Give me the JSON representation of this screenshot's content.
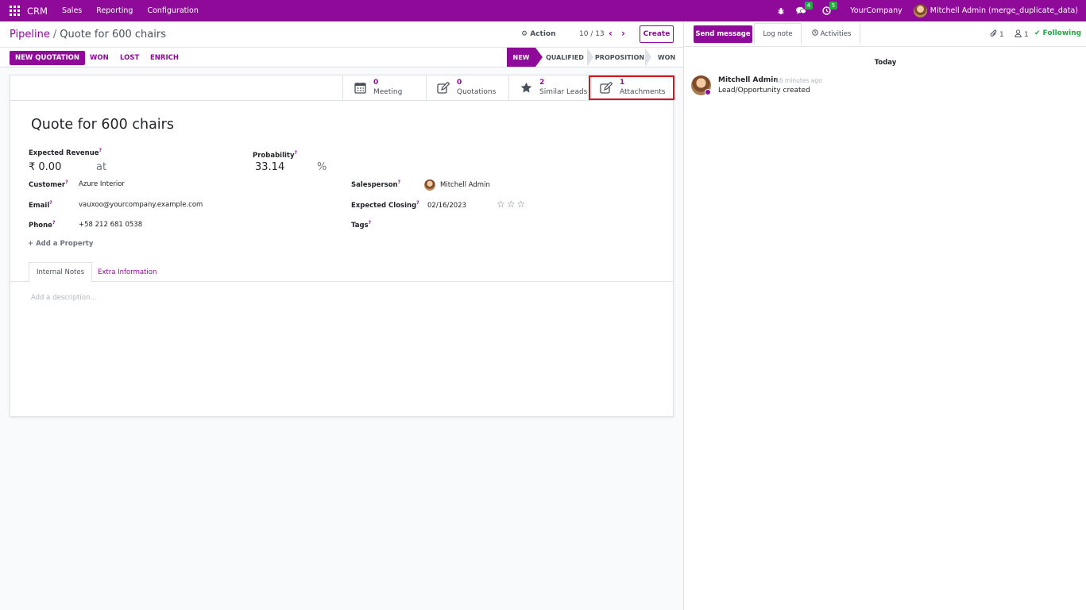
{
  "topbar": {
    "brand": "CRM",
    "menus": [
      "Sales",
      "Reporting",
      "Configuration"
    ],
    "messages_badge": "4",
    "activities_badge": "5",
    "company": "YourCompany",
    "user": "Mitchell Admin (merge_duplicate_data)"
  },
  "breadcrumb": {
    "parent": "Pipeline",
    "separator": "/",
    "current": "Quote for 600 chairs"
  },
  "control": {
    "action_label": "Action",
    "pager": "10 / 13",
    "create_label": "Create"
  },
  "statusbar": {
    "new_quotation": "NEW QUOTATION",
    "won": "WON",
    "lost": "LOST",
    "enrich": "ENRICH",
    "stages": [
      "NEW",
      "QUALIFIED",
      "PROPOSITION",
      "WON"
    ],
    "active_stage": "NEW"
  },
  "smart_buttons": [
    {
      "count": "0",
      "label": "Meeting",
      "icon": "calendar-icon"
    },
    {
      "count": "0",
      "label": "Quotations",
      "icon": "edit-icon"
    },
    {
      "count": "2",
      "label": "Similar Leads",
      "icon": "star-icon"
    },
    {
      "count": "1",
      "label": "Attachments",
      "icon": "edit-icon"
    }
  ],
  "form": {
    "title": "Quote for 600 chairs",
    "expected_revenue_label": "Expected Revenue",
    "expected_revenue": "₹ 0.00",
    "at_label": "at",
    "probability_label": "Probability",
    "probability": "33.14",
    "percent": "%",
    "customer_label": "Customer",
    "customer": "Azure Interior",
    "email_label": "Email",
    "email": "vauxoo@yourcompany.example.com",
    "phone_label": "Phone",
    "phone": "+58 212 681 0538",
    "salesperson_label": "Salesperson",
    "salesperson": "Mitchell Admin",
    "expected_closing_label": "Expected Closing",
    "expected_closing": "02/16/2023",
    "priority_stars": "☆☆☆",
    "tags_label": "Tags",
    "help_mark": "?",
    "add_property": "Add a Property",
    "tabs": [
      "Internal Notes",
      "Extra Information"
    ],
    "description_placeholder": "Add a description..."
  },
  "chatter": {
    "send_message": "Send message",
    "log_note": "Log note",
    "activities": "Activities",
    "attachments_count": "1",
    "followers_count": "1",
    "following": "Following",
    "date_separator": "Today",
    "message": {
      "author": "Mitchell Admin",
      "time": "- 16 minutes ago",
      "body": "Lead/Opportunity created"
    }
  },
  "colors": {
    "brand": "#8f0a99",
    "following": "#28a745",
    "highlight": "#d9121b"
  }
}
